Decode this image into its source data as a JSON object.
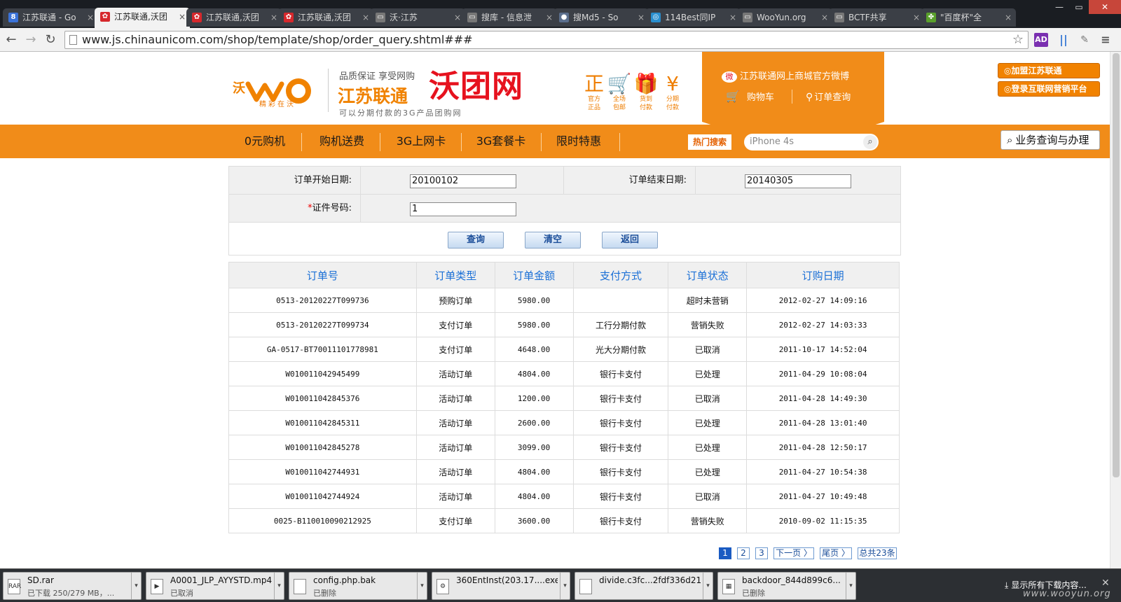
{
  "browser": {
    "tabs": [
      {
        "title": "江苏联通 - Go",
        "fav": "8",
        "color": "#3b73d9"
      },
      {
        "title": "江苏联通,沃团",
        "fav": "✿",
        "color": "#d6282c"
      },
      {
        "title": "江苏联通,沃团",
        "fav": "✿",
        "color": "#d6282c"
      },
      {
        "title": "江苏联通,沃团",
        "fav": "✿",
        "color": "#d6282c"
      },
      {
        "title": "沃·江苏",
        "fav": "▭",
        "color": "#777"
      },
      {
        "title": "搜库 - 信息泄",
        "fav": "▭",
        "color": "#777"
      },
      {
        "title": "搜Md5 - So",
        "fav": "●",
        "color": "#5a6e8c"
      },
      {
        "title": "114Best同IP",
        "fav": "◎",
        "color": "#2a8fcf"
      },
      {
        "title": "WooYun.org",
        "fav": "▭",
        "color": "#777"
      },
      {
        "title": "BCTF共享",
        "fav": "▭",
        "color": "#777"
      },
      {
        "title": "\"百度杯\"全",
        "fav": "✤",
        "color": "#5aa02c"
      }
    ],
    "active_tab": 1,
    "url": "www.js.chinaunicom.com/shop/template/shop/order_query.shtml###",
    "window_buttons": [
      "—",
      "▭",
      "✕"
    ]
  },
  "header": {
    "logo_slogan": "精彩在沃",
    "quality": "品质保证  享受网购",
    "brand_main": "江苏联通",
    "brand_name": "沃团网",
    "brand_sub": "可以分期付款的3G产品团购网",
    "features": [
      {
        "icon": "正",
        "label1": "官方",
        "label2": "正品"
      },
      {
        "icon": "🛒",
        "label1": "全场",
        "label2": "包邮"
      },
      {
        "icon": "🎁",
        "label1": "货到",
        "label2": "付款"
      },
      {
        "icon": "¥",
        "label1": "分期",
        "label2": "付款"
      }
    ],
    "weibo": "江苏联通网上商城官方微博",
    "cart": "购物车",
    "order_query": "订单查询",
    "side_buttons": [
      "加盟江苏联通",
      "登录互联网营销平台"
    ]
  },
  "nav": {
    "items": [
      "0元购机",
      "购机送费",
      "3G上网卡",
      "3G套餐卡",
      "限时特惠"
    ],
    "hot_search": "热门搜索",
    "search_placeholder": "iPhone 4s",
    "biz_button": "业务查询与办理"
  },
  "form": {
    "start_label": "订单开始日期:",
    "start_value": "20100102",
    "end_label": "订单结束日期:",
    "end_value": "20140305",
    "id_label": "证件号码:",
    "id_value": "1",
    "required_mark": "*",
    "buttons": {
      "query": "查询",
      "clear": "清空",
      "back": "返回"
    }
  },
  "table": {
    "columns": [
      "订单号",
      "订单类型",
      "订单金额",
      "支付方式",
      "订单状态",
      "订购日期"
    ],
    "rows": [
      [
        "0513-20120227T099736",
        "预购订单",
        "5980.00",
        "",
        "超时未营销",
        "2012-02-27 14:09:16"
      ],
      [
        "0513-20120227T099734",
        "支付订单",
        "5980.00",
        "工行分期付款",
        "营销失败",
        "2012-02-27 14:03:33"
      ],
      [
        "GA-0517-BT70011101778981",
        "支付订单",
        "4648.00",
        "光大分期付款",
        "已取消",
        "2011-10-17 14:52:04"
      ],
      [
        "W010011042945499",
        "活动订单",
        "4804.00",
        "银行卡支付",
        "已处理",
        "2011-04-29 10:08:04"
      ],
      [
        "W010011042845376",
        "活动订单",
        "1200.00",
        "银行卡支付",
        "已取消",
        "2011-04-28 14:49:30"
      ],
      [
        "W010011042845311",
        "活动订单",
        "2600.00",
        "银行卡支付",
        "已处理",
        "2011-04-28 13:01:40"
      ],
      [
        "W010011042845278",
        "活动订单",
        "3099.00",
        "银行卡支付",
        "已处理",
        "2011-04-28 12:50:17"
      ],
      [
        "W010011042744931",
        "活动订单",
        "4804.00",
        "银行卡支付",
        "已处理",
        "2011-04-27 10:54:38"
      ],
      [
        "W010011042744924",
        "活动订单",
        "4804.00",
        "银行卡支付",
        "已取消",
        "2011-04-27 10:49:48"
      ],
      [
        "0025-B110010090212925",
        "支付订单",
        "3600.00",
        "银行卡支付",
        "营销失败",
        "2010-09-02 11:15:35"
      ]
    ]
  },
  "pagination": {
    "pages": [
      "1",
      "2",
      "3"
    ],
    "current": "1",
    "next": "下一页 〉",
    "last": "尾页 〉",
    "total": "总共23条"
  },
  "downloads": {
    "items": [
      {
        "name": "SD.rar",
        "status": "已下载 250/279 MB，...",
        "icon": "RAR"
      },
      {
        "name": "A0001_JLP_AYYSTD.mp4",
        "status": "已取消",
        "icon": "▶"
      },
      {
        "name": "config.php.bak",
        "status": "已删除",
        "icon": ""
      },
      {
        "name": "360EntInst(203.17....exe",
        "status": "",
        "icon": "⚙"
      },
      {
        "name": "divide.c3fc...2fdf336d21",
        "status": "",
        "icon": ""
      },
      {
        "name": "backdoor_844d899c6...",
        "status": "已删除",
        "icon": "▦"
      }
    ],
    "show_all": "显示所有下载内容...",
    "close": "✕"
  },
  "watermark": "www.wooyun.org"
}
